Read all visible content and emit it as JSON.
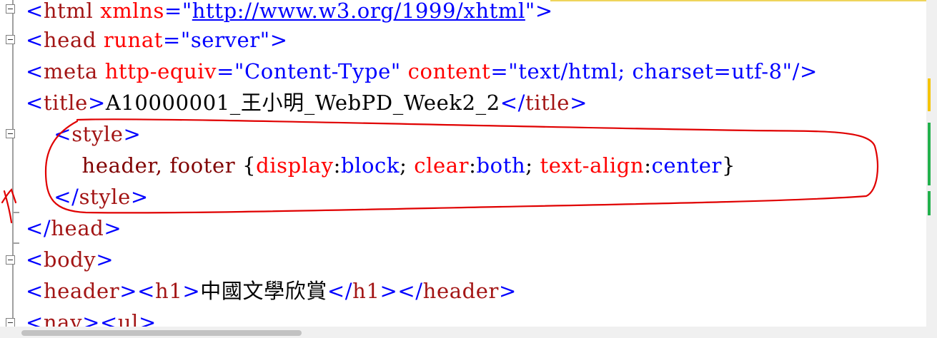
{
  "lines": [
    {
      "id": "html",
      "tokens": [
        {
          "c": "d",
          "text": "<"
        },
        {
          "c": "t",
          "text": "html"
        },
        {
          "c": "a",
          "text": " xmlns"
        },
        {
          "c": "d",
          "text": "=\""
        },
        {
          "c": "u",
          "text": "http://www.w3.org/1999/xhtml"
        },
        {
          "c": "d",
          "text": "\">"
        }
      ]
    },
    {
      "id": "head",
      "tokens": [
        {
          "c": "d",
          "text": "<"
        },
        {
          "c": "t",
          "text": "head"
        },
        {
          "c": "a",
          "text": " runat"
        },
        {
          "c": "d",
          "text": "=\""
        },
        {
          "c": "v",
          "text": "server"
        },
        {
          "c": "d",
          "text": "\">"
        }
      ]
    },
    {
      "id": "meta",
      "tokens": [
        {
          "c": "d",
          "text": "<"
        },
        {
          "c": "t",
          "text": "meta"
        },
        {
          "c": "a",
          "text": " http-equiv"
        },
        {
          "c": "d",
          "text": "=\""
        },
        {
          "c": "v",
          "text": "Content-Type"
        },
        {
          "c": "d",
          "text": "\""
        },
        {
          "c": "a",
          "text": " content"
        },
        {
          "c": "d",
          "text": "=\""
        },
        {
          "c": "v",
          "text": "text/html; charset=utf-8"
        },
        {
          "c": "d",
          "text": "\"/>"
        }
      ]
    },
    {
      "id": "title",
      "tokens": [
        {
          "c": "d",
          "text": "<"
        },
        {
          "c": "t",
          "text": "title"
        },
        {
          "c": "d",
          "text": ">"
        },
        {
          "c": "k",
          "text": "A10000001_王小明_WebPD_Week2_2"
        },
        {
          "c": "d",
          "text": "</"
        },
        {
          "c": "t",
          "text": "title"
        },
        {
          "c": "d",
          "text": ">"
        }
      ]
    },
    {
      "id": "style-open",
      "tokens": [
        {
          "c": "k",
          "text": "    "
        },
        {
          "c": "d",
          "text": "<"
        },
        {
          "c": "t",
          "text": "style"
        },
        {
          "c": "d",
          "text": ">"
        }
      ]
    },
    {
      "id": "css-rule",
      "tokens": [
        {
          "c": "k",
          "text": "        "
        },
        {
          "c": "sel",
          "text": "header, footer "
        },
        {
          "c": "k",
          "text": "{"
        },
        {
          "c": "a",
          "text": "display"
        },
        {
          "c": "k",
          "text": ":"
        },
        {
          "c": "v",
          "text": "block"
        },
        {
          "c": "k",
          "text": "; "
        },
        {
          "c": "a",
          "text": "clear"
        },
        {
          "c": "k",
          "text": ":"
        },
        {
          "c": "v",
          "text": "both"
        },
        {
          "c": "k",
          "text": "; "
        },
        {
          "c": "a",
          "text": "text-align"
        },
        {
          "c": "k",
          "text": ":"
        },
        {
          "c": "v",
          "text": "center"
        },
        {
          "c": "k",
          "text": "}"
        }
      ]
    },
    {
      "id": "style-close",
      "tokens": [
        {
          "c": "k",
          "text": "    "
        },
        {
          "c": "d",
          "text": "</"
        },
        {
          "c": "t",
          "text": "style"
        },
        {
          "c": "d",
          "text": ">"
        }
      ]
    },
    {
      "id": "head-close",
      "tokens": [
        {
          "c": "d",
          "text": "</"
        },
        {
          "c": "t",
          "text": "head"
        },
        {
          "c": "d",
          "text": ">"
        }
      ]
    },
    {
      "id": "body",
      "tokens": [
        {
          "c": "d",
          "text": "<"
        },
        {
          "c": "t",
          "text": "body"
        },
        {
          "c": "d",
          "text": ">"
        }
      ]
    },
    {
      "id": "header",
      "tokens": [
        {
          "c": "d",
          "text": "<"
        },
        {
          "c": "t",
          "text": "header"
        },
        {
          "c": "d",
          "text": "><"
        },
        {
          "c": "t",
          "text": "h1"
        },
        {
          "c": "d",
          "text": ">"
        },
        {
          "c": "k",
          "text": "中國文學欣賞"
        },
        {
          "c": "d",
          "text": "</"
        },
        {
          "c": "t",
          "text": "h1"
        },
        {
          "c": "d",
          "text": "></"
        },
        {
          "c": "t",
          "text": "header"
        },
        {
          "c": "d",
          "text": ">"
        }
      ]
    },
    {
      "id": "nav",
      "tokens": [
        {
          "c": "d",
          "text": "<"
        },
        {
          "c": "t",
          "text": "nav"
        },
        {
          "c": "d",
          "text": "><"
        },
        {
          "c": "t",
          "text": "ul"
        },
        {
          "c": "d",
          "text": ">"
        }
      ]
    }
  ],
  "colors": {
    "tag": "#a31515",
    "delimiter": "#0000ff",
    "attribute": "#ff0000",
    "value": "#0000ff",
    "selector": "#800000",
    "annotation": "#e00000",
    "change_saved": "#22b14c",
    "change_unsaved": "#f5c400"
  }
}
